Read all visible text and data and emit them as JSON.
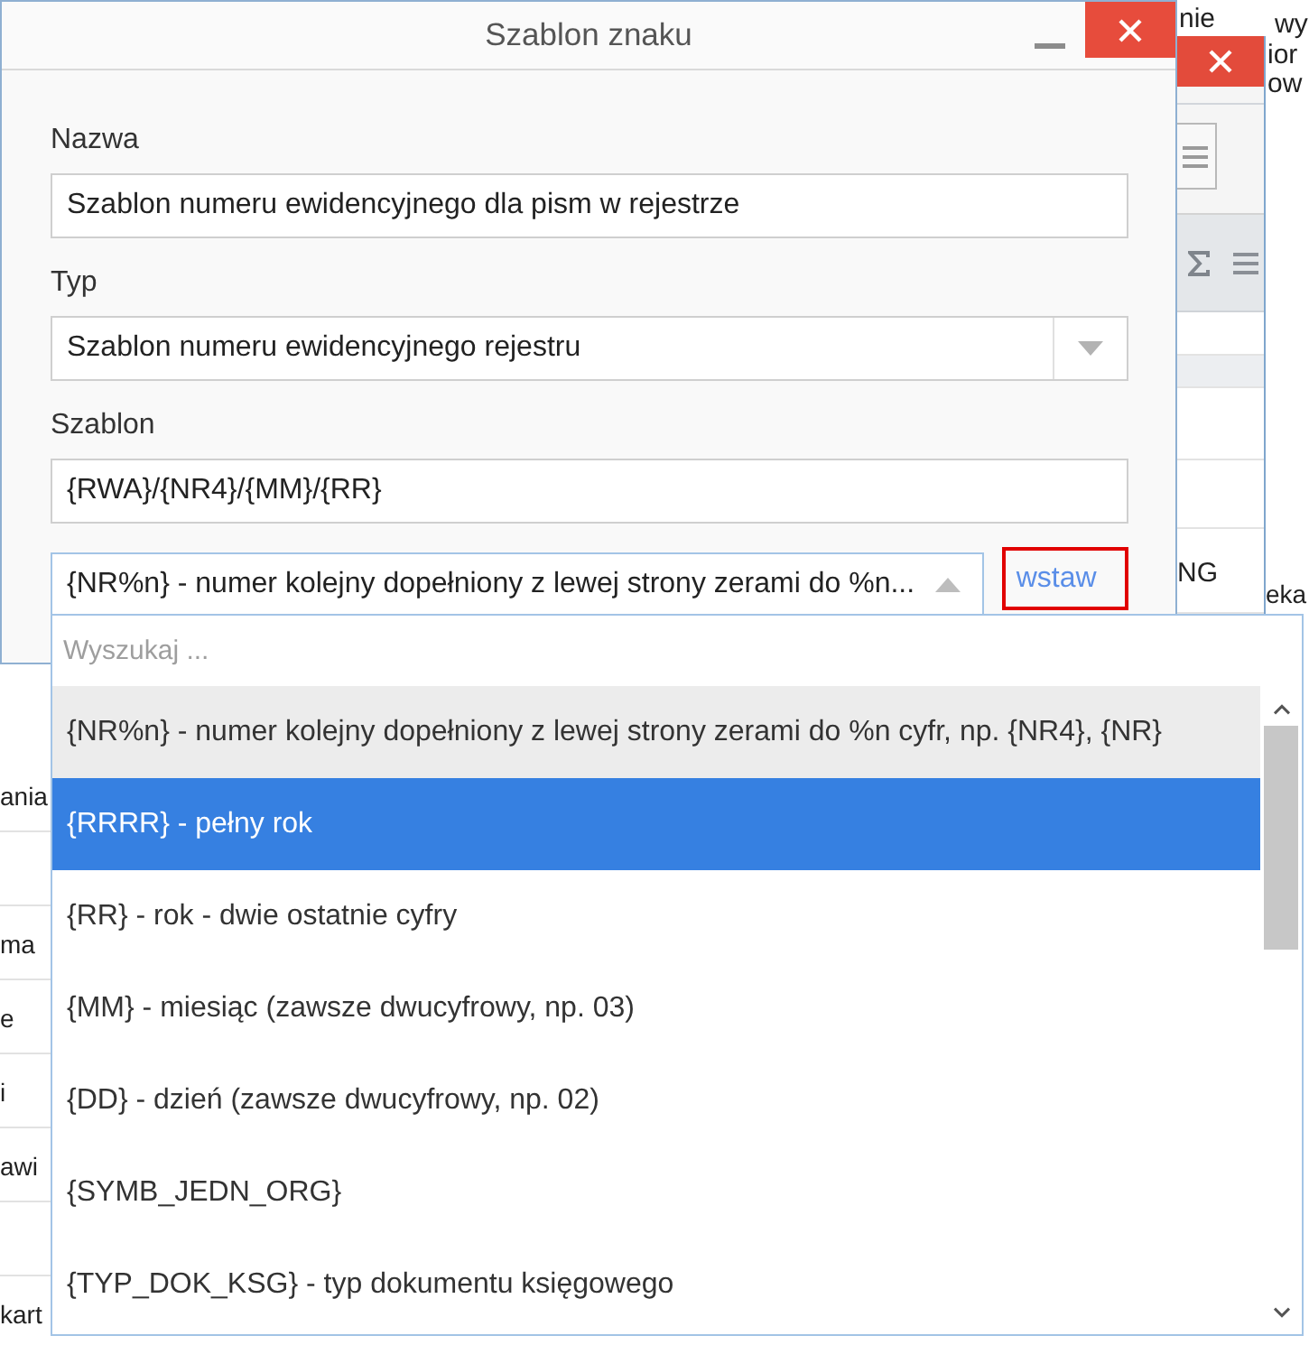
{
  "background": {
    "top_texts": [
      "nie",
      "wy",
      "ior",
      "ow"
    ],
    "window": {
      "cell_text": "NG"
    },
    "side_texts": [
      "ania",
      "ma",
      "e",
      "i",
      "awi",
      "kart"
    ],
    "edge_text": "eka"
  },
  "dialog": {
    "title": "Szablon znaku",
    "fields": [
      {
        "kind": "text",
        "label": "Nazwa",
        "value": "Szablon numeru ewidencyjnego dla pism w rejestrze"
      },
      {
        "kind": "select",
        "label": "Typ",
        "value": "Szablon numeru ewidencyjnego rejestru"
      },
      {
        "kind": "text",
        "label": "Szablon",
        "value": "{RWA}/{NR4}/{MM}/{RR}"
      }
    ],
    "token_picker": {
      "value": "{NR%n} - numer kolejny dopełniony z lewej strony zerami do %n...",
      "expanded": true,
      "search": {
        "placeholder": "Wyszukaj ..."
      },
      "options": [
        {
          "label": "{NR%n} - numer kolejny dopełniony z lewej strony zerami do %n cyfr, np. {NR4}, {NR}",
          "selected": true,
          "highlighted": false
        },
        {
          "label": "{RRRR} - pełny rok",
          "selected": false,
          "highlighted": true
        },
        {
          "label": "{RR} - rok - dwie ostatnie cyfry",
          "selected": false,
          "highlighted": false
        },
        {
          "label": "{MM} - miesiąc (zawsze dwucyfrowy, np. 03)",
          "selected": false,
          "highlighted": false
        },
        {
          "label": "{DD} - dzień (zawsze dwucyfrowy, np. 02)",
          "selected": false,
          "highlighted": false
        },
        {
          "label": "{SYMB_JEDN_ORG}",
          "selected": false,
          "highlighted": false
        },
        {
          "label": "{TYP_DOK_KSG} - typ dokumentu księgowego",
          "selected": false,
          "highlighted": false
        }
      ]
    },
    "insert_link": {
      "label": "wstaw",
      "outlined": true
    }
  }
}
